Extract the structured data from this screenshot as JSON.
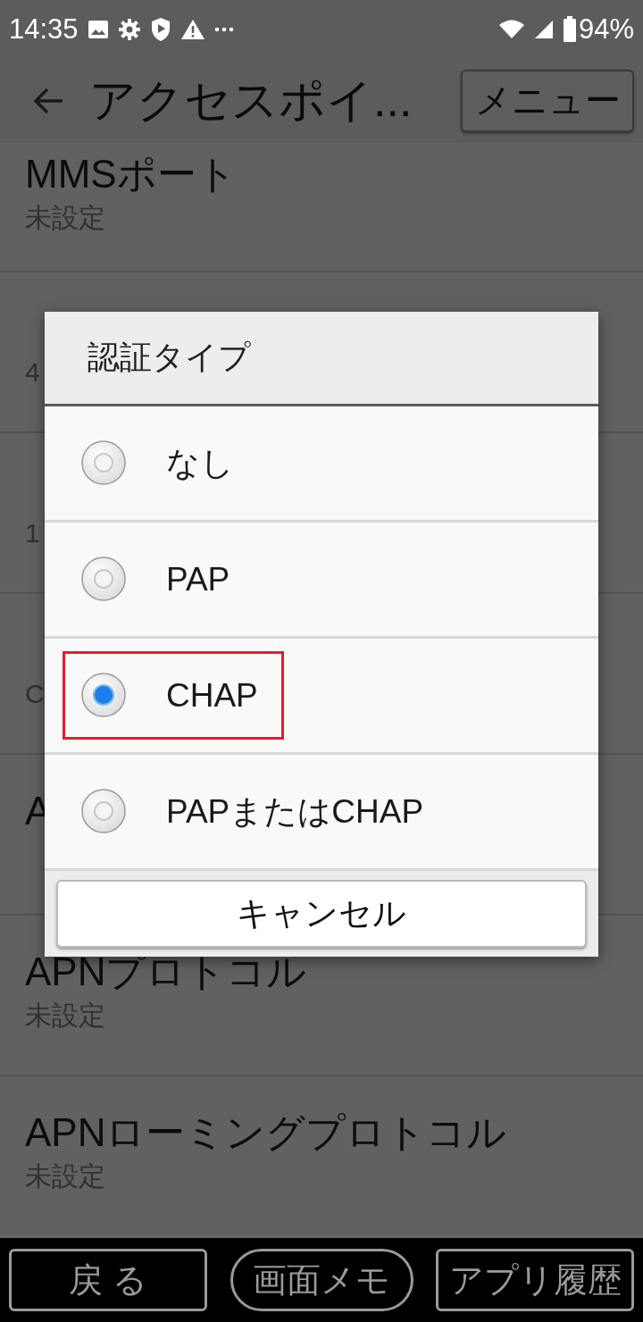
{
  "status_bar": {
    "time": "14:35",
    "battery": "94%"
  },
  "app_bar": {
    "title": "アクセスポイ...",
    "menu_button": "メニュー"
  },
  "settings": [
    {
      "title": "MMSポート",
      "value": "未設定"
    },
    {
      "value": "4"
    },
    {
      "value": "1"
    },
    {
      "value": "C"
    },
    {
      "title": "A"
    },
    {
      "title": "APNプロトコル",
      "value": "未設定"
    },
    {
      "title": "APNローミングプロトコル",
      "value": "未設定"
    }
  ],
  "dialog": {
    "title": "認証タイプ",
    "options": [
      {
        "label": "なし",
        "selected": false,
        "highlighted": false
      },
      {
        "label": "PAP",
        "selected": false,
        "highlighted": false
      },
      {
        "label": "CHAP",
        "selected": true,
        "highlighted": true
      },
      {
        "label": "PAPまたはCHAP",
        "selected": false,
        "highlighted": false
      }
    ],
    "cancel_button": "キャンセル"
  },
  "nav_bar": [
    {
      "label": "戻 る",
      "kind": "box"
    },
    {
      "label": "画面メモ",
      "kind": "pill"
    },
    {
      "label": "アプリ履歴",
      "kind": "box"
    }
  ]
}
